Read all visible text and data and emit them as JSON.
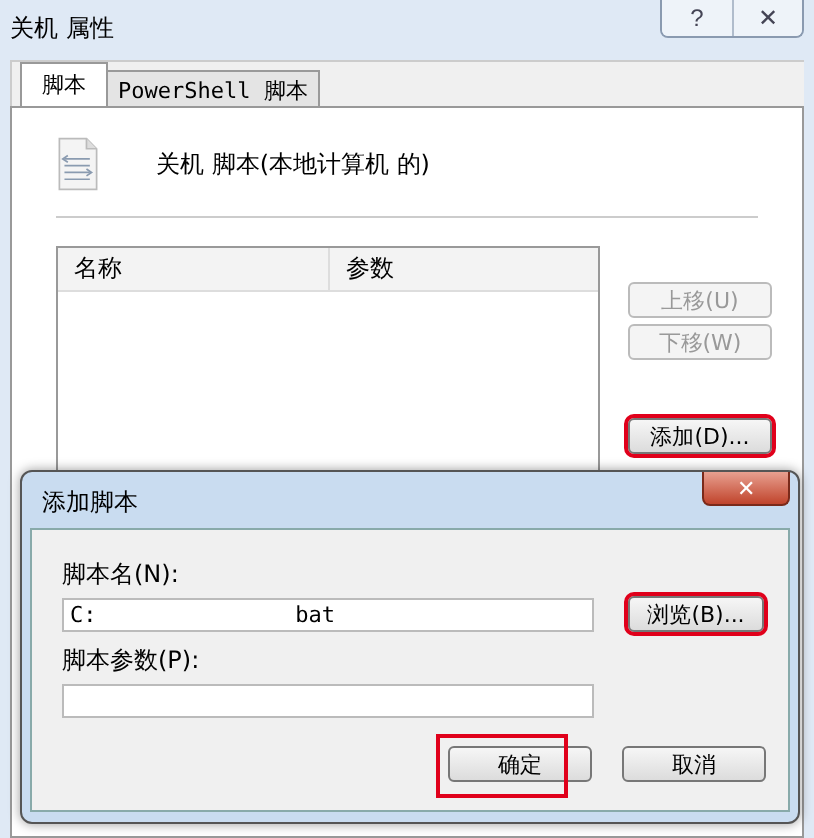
{
  "window": {
    "title": "关机 属性",
    "caption_buttons": [
      "?",
      "✕"
    ]
  },
  "tabs": [
    {
      "label": "脚本",
      "selected": true
    },
    {
      "label": "PowerShell 脚本",
      "selected": false
    }
  ],
  "heading": "关机 脚本(本地计算机 的)",
  "table": {
    "columns": [
      "名称",
      "参数"
    ]
  },
  "side_buttons": [
    {
      "label": "上移(U)",
      "disabled": true,
      "highlighted": false
    },
    {
      "label": "下移(W)",
      "disabled": true,
      "highlighted": false
    },
    {
      "label": "添加(D)...",
      "disabled": false,
      "highlighted": true
    }
  ],
  "dialog": {
    "title": "添加脚本",
    "close": "✕",
    "fields": [
      {
        "label": "脚本名(N):",
        "value": "C:               bat",
        "button": {
          "label": "浏览(B)...",
          "highlighted": true
        }
      },
      {
        "label": "脚本参数(P):"
      }
    ],
    "buttons": [
      {
        "label": "确定",
        "highlighted": true
      },
      {
        "label": "取消",
        "highlighted": false
      }
    ]
  }
}
